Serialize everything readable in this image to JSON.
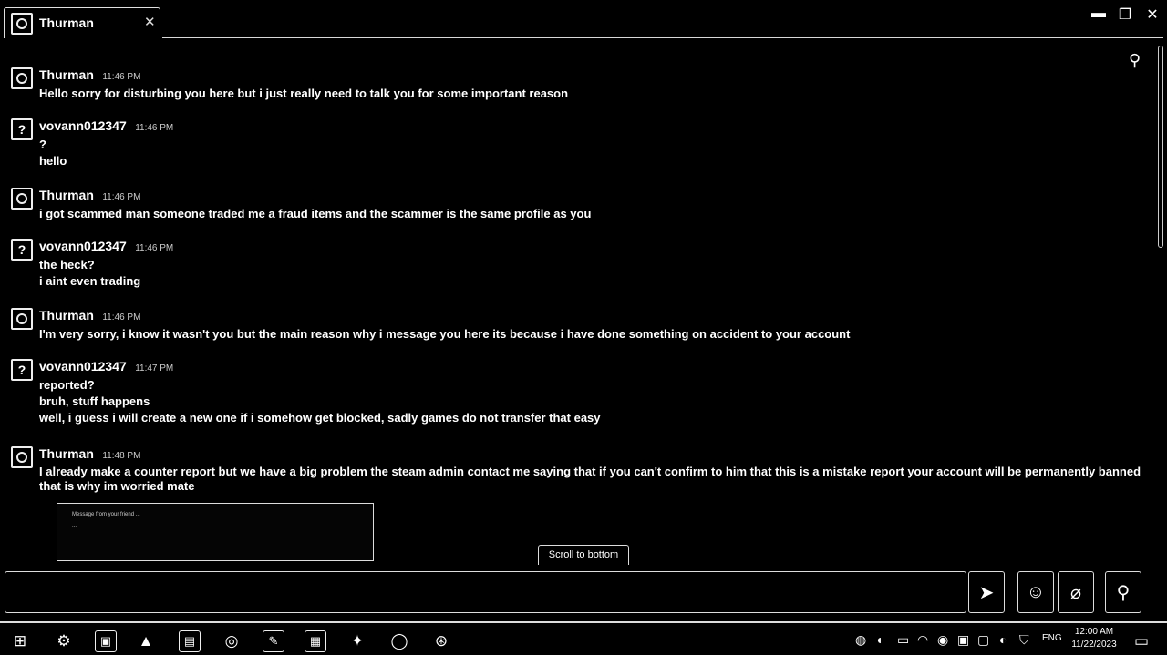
{
  "window": {
    "tab_title": "Thurman",
    "tab_close_icon": "close-icon",
    "controls": [
      "minimize-icon",
      "restore-icon",
      "close-icon"
    ]
  },
  "messages": [
    {
      "sender": "Thurman",
      "time": "11:46 PM",
      "avatar": "face",
      "lines": [
        "Hello sorry for disturbing you here but i just really need to talk you for some important reason"
      ]
    },
    {
      "sender": "vovann012347",
      "time": "11:46 PM",
      "avatar": "question",
      "lines": [
        "?",
        "hello"
      ]
    },
    {
      "sender": "Thurman",
      "time": "11:46 PM",
      "avatar": "face",
      "lines": [
        "i got scammed man someone traded me a fraud items and the scammer is the same profile as you"
      ]
    },
    {
      "sender": "vovann012347",
      "time": "11:46 PM",
      "avatar": "question",
      "lines": [
        "the heck?",
        "i aint even trading"
      ]
    },
    {
      "sender": "Thurman",
      "time": "11:46 PM",
      "avatar": "face",
      "lines": [
        "I'm very sorry, i know it wasn't you but the main reason why i message you here its because i have done something on accident to your account"
      ]
    },
    {
      "sender": "vovann012347",
      "time": "11:47 PM",
      "avatar": "question",
      "lines": [
        "reported?",
        "bruh, stuff happens",
        "well, i guess i will create a new one if i somehow get blocked, sadly games do not transfer that easy"
      ]
    },
    {
      "sender": "Thurman",
      "time": "11:48 PM",
      "avatar": "face",
      "lines": [
        "I already make a counter report but we have a big problem the steam admin contact me saying that if you can't confirm to him that this is a mistake report your account will be permanently banned that is why im worried mate"
      ]
    }
  ],
  "attachment": {
    "lines": [
      "Message from your friend ...",
      "...",
      "..."
    ]
  },
  "scroll_to_bottom": "Scroll to bottom",
  "input": {
    "placeholder": "",
    "send_icon": "send-icon",
    "emoji_icon": "emoji-icon",
    "attach_icon": "paperclip-icon",
    "voice_icon": "microphone-icon"
  },
  "taskbar": {
    "clock_time": "12:00 AM",
    "clock_date": "11/22/2023",
    "language": "ENG"
  }
}
